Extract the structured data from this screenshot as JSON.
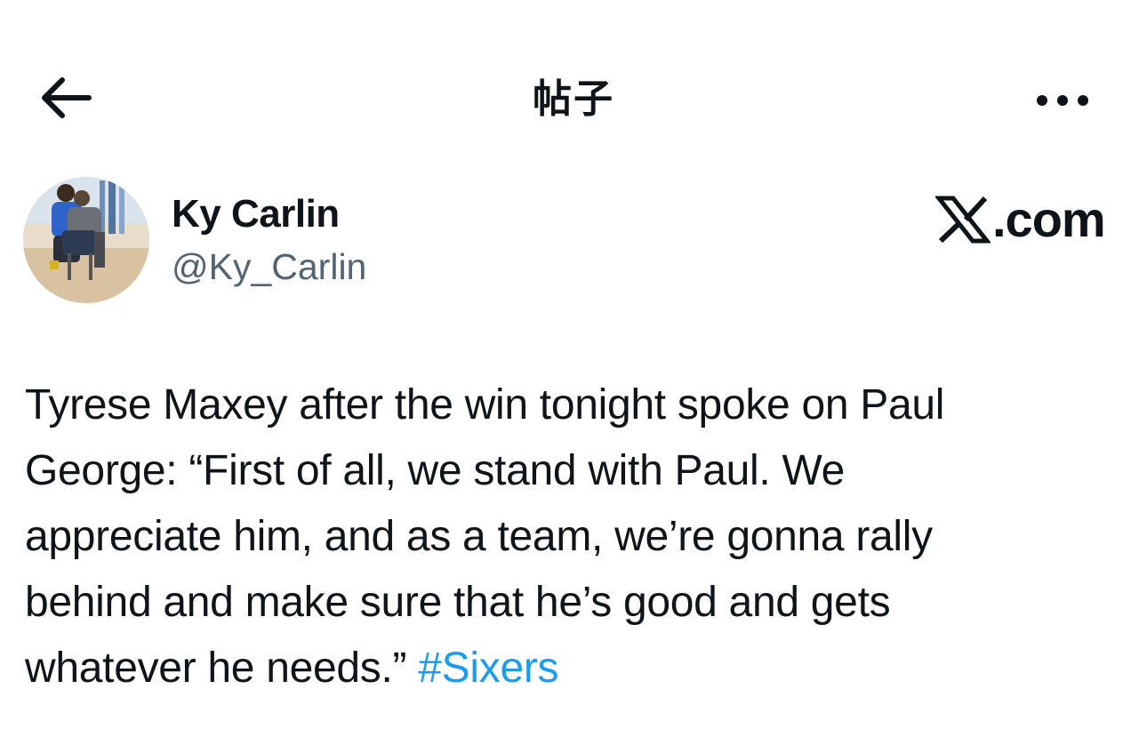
{
  "header": {
    "title": "帖子",
    "back_icon": "arrow-left-icon",
    "more_icon": "more-horizontal-icon"
  },
  "author": {
    "display_name": "Ky Carlin",
    "handle": "@Ky_Carlin",
    "avatar_icon": "avatar-photo"
  },
  "brand": {
    "logo_icon": "x-logo-icon",
    "text": ".com"
  },
  "post": {
    "lines": [
      "Tyrese Maxey after the win tonight spoke on Paul",
      "George: “First of all, we stand with Paul. We",
      "appreciate him, and as a team, we’re gonna rally",
      "behind and make sure that he’s good and gets",
      "whatever he needs.” "
    ],
    "hashtag": "#Sixers"
  },
  "colors": {
    "text": "#0f1419",
    "secondary": "#536471",
    "link": "#1d9bf0",
    "background": "#ffffff"
  }
}
